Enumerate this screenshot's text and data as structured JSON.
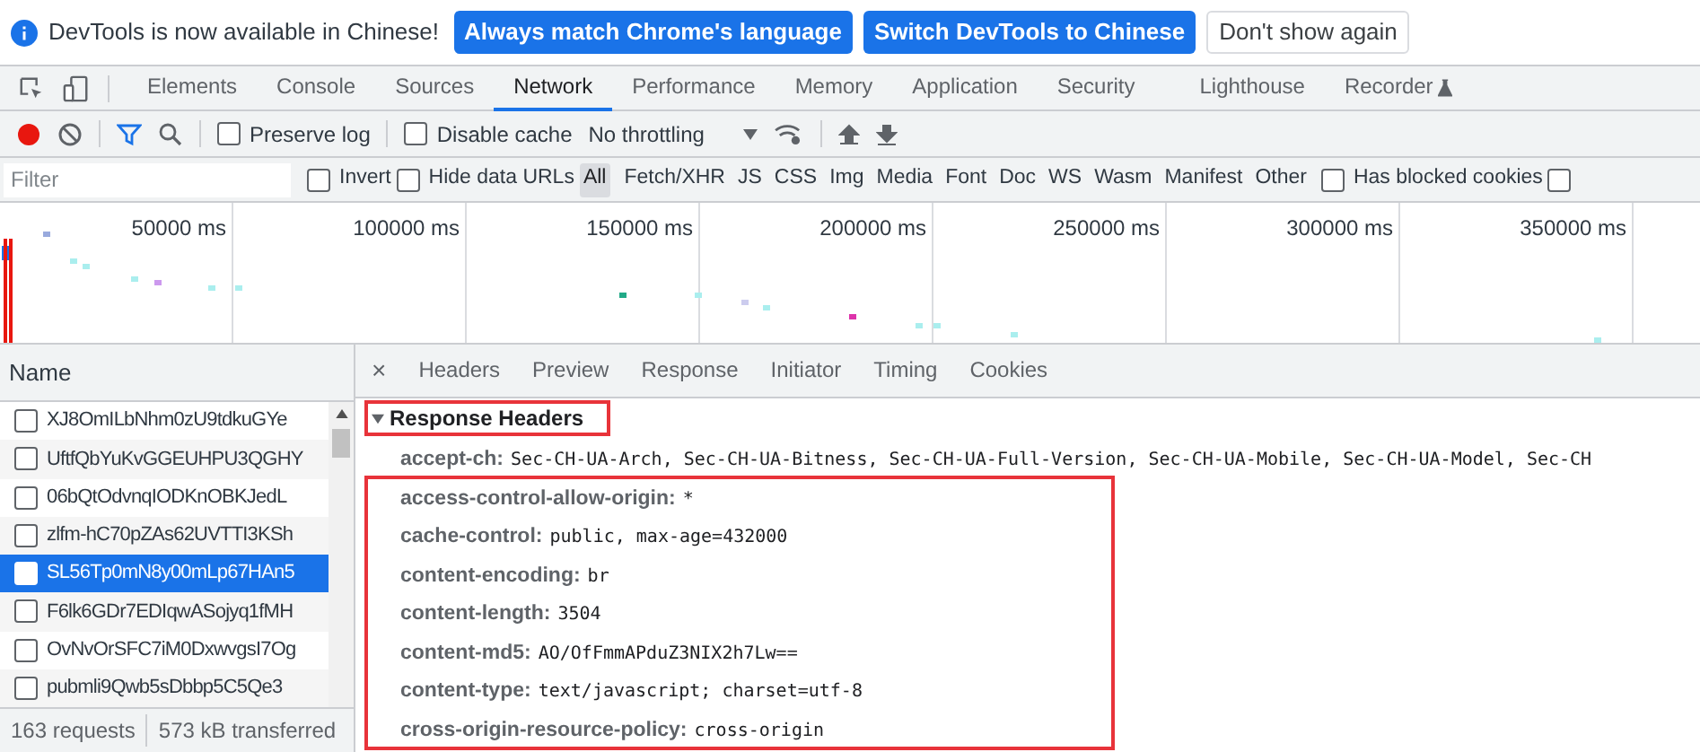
{
  "banner": {
    "message": "DevTools is now available in Chinese!",
    "buttons": [
      {
        "label": "Always match Chrome's language",
        "kind": "primary"
      },
      {
        "label": "Switch DevTools to Chinese",
        "kind": "primary"
      },
      {
        "label": "Don't show again",
        "kind": "secondary"
      }
    ]
  },
  "tabs": [
    {
      "label": "Elements",
      "selected": false
    },
    {
      "label": "Console",
      "selected": false
    },
    {
      "label": "Sources",
      "selected": false
    },
    {
      "label": "Network",
      "selected": true
    },
    {
      "label": "Performance",
      "selected": false
    },
    {
      "label": "Memory",
      "selected": false
    },
    {
      "label": "Application",
      "selected": false
    },
    {
      "label": "Security",
      "selected": false
    },
    {
      "label": "Lighthouse",
      "selected": false
    },
    {
      "label": "Recorder",
      "selected": false
    }
  ],
  "toolbar": {
    "recording": true,
    "filter_active": true,
    "preserve_log": {
      "label": "Preserve log",
      "checked": false
    },
    "disable_cache": {
      "label": "Disable cache",
      "checked": false
    },
    "throttling": "No throttling"
  },
  "filter_bar": {
    "placeholder": "Filter",
    "invert": {
      "label": "Invert",
      "checked": false
    },
    "hide_data_urls": {
      "label": "Hide data URLs",
      "checked": false
    },
    "types": [
      {
        "label": "All",
        "selected": true
      },
      {
        "label": "Fetch/XHR",
        "selected": false
      },
      {
        "label": "JS",
        "selected": false
      },
      {
        "label": "CSS",
        "selected": false
      },
      {
        "label": "Img",
        "selected": false
      },
      {
        "label": "Media",
        "selected": false
      },
      {
        "label": "Font",
        "selected": false
      },
      {
        "label": "Doc",
        "selected": false
      },
      {
        "label": "WS",
        "selected": false
      },
      {
        "label": "Wasm",
        "selected": false
      },
      {
        "label": "Manifest",
        "selected": false
      },
      {
        "label": "Other",
        "selected": false
      }
    ],
    "blocked_cookies": {
      "label": "Has blocked cookies",
      "checked": false
    },
    "checkbox_2": {
      "checked": false
    }
  },
  "overview": {
    "ticks": [
      "50000 ms",
      "100000 ms",
      "150000 ms",
      "200000 ms",
      "250000 ms",
      "300000 ms",
      "350000 ms"
    ]
  },
  "requests": {
    "column": "Name",
    "rows": [
      {
        "name": "XJ8OmILbNhm0zU9tdkuGYe",
        "selected": false,
        "checked": false
      },
      {
        "name": "UftfQbYuKvGGEUHPU3QGHY",
        "selected": false,
        "checked": false
      },
      {
        "name": "06bQtOdvnqIODKnOBKJedL",
        "selected": false,
        "checked": false
      },
      {
        "name": "zlfm-hC70pZAs62UVTTI3KSh",
        "selected": false,
        "checked": false
      },
      {
        "name": "SL56Tp0mN8y00mLp67HAn5",
        "selected": true,
        "checked": false
      },
      {
        "name": "F6lk6GDr7EDIqwASojyq1fMH",
        "selected": false,
        "checked": false
      },
      {
        "name": "OvNvOrSFC7iM0DxwvgsI7Og",
        "selected": false,
        "checked": false
      },
      {
        "name": "pubmli9Qwb5sDbbp5C5Qe3",
        "selected": false,
        "checked": false
      }
    ],
    "summary": [
      "163 requests",
      "573 kB transferred"
    ]
  },
  "detail": {
    "close": "×",
    "tabs": [
      {
        "label": "Headers",
        "selected": false
      },
      {
        "label": "Preview",
        "selected": false
      },
      {
        "label": "Response",
        "selected": false
      },
      {
        "label": "Initiator",
        "selected": false
      },
      {
        "label": "Timing",
        "selected": false
      },
      {
        "label": "Cookies",
        "selected": false
      }
    ],
    "section": {
      "title": "Response Headers",
      "expanded": true
    },
    "headers": [
      {
        "name": "accept-ch:",
        "value": "Sec-CH-UA-Arch, Sec-CH-UA-Bitness, Sec-CH-UA-Full-Version, Sec-CH-UA-Mobile, Sec-CH-UA-Model, Sec-CH"
      },
      {
        "name": "access-control-allow-origin:",
        "value": "*"
      },
      {
        "name": "cache-control:",
        "value": "public, max-age=432000"
      },
      {
        "name": "content-encoding:",
        "value": "br"
      },
      {
        "name": "content-length:",
        "value": "3504"
      },
      {
        "name": "content-md5:",
        "value": "AO/OfFmmAPduZ3NIX2h7Lw=="
      },
      {
        "name": "content-type:",
        "value": "text/javascript; charset=utf-8"
      },
      {
        "name": "cross-origin-resource-policy:",
        "value": "cross-origin"
      }
    ]
  }
}
